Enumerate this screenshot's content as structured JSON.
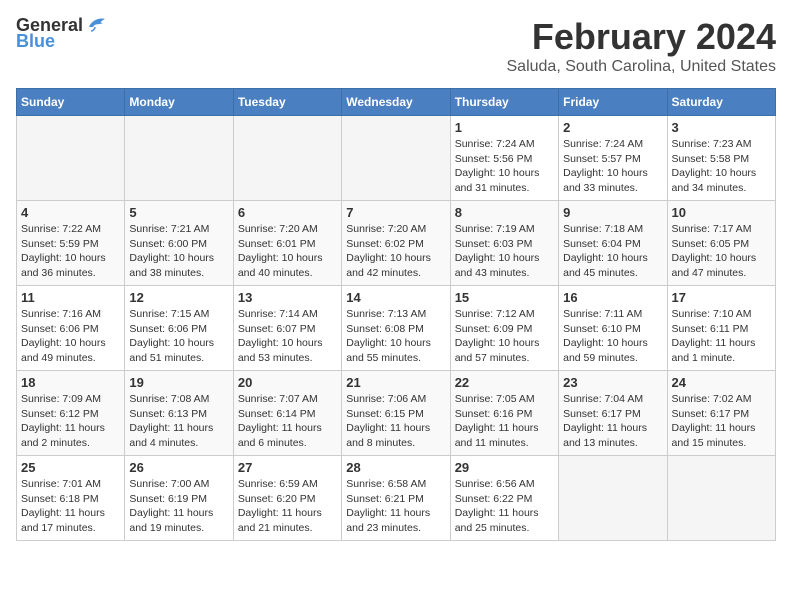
{
  "header": {
    "logo_line1": "General",
    "logo_line2": "Blue",
    "month": "February 2024",
    "location": "Saluda, South Carolina, United States"
  },
  "weekdays": [
    "Sunday",
    "Monday",
    "Tuesday",
    "Wednesday",
    "Thursday",
    "Friday",
    "Saturday"
  ],
  "weeks": [
    [
      {
        "day": "",
        "info": ""
      },
      {
        "day": "",
        "info": ""
      },
      {
        "day": "",
        "info": ""
      },
      {
        "day": "",
        "info": ""
      },
      {
        "day": "1",
        "info": "Sunrise: 7:24 AM\nSunset: 5:56 PM\nDaylight: 10 hours\nand 31 minutes."
      },
      {
        "day": "2",
        "info": "Sunrise: 7:24 AM\nSunset: 5:57 PM\nDaylight: 10 hours\nand 33 minutes."
      },
      {
        "day": "3",
        "info": "Sunrise: 7:23 AM\nSunset: 5:58 PM\nDaylight: 10 hours\nand 34 minutes."
      }
    ],
    [
      {
        "day": "4",
        "info": "Sunrise: 7:22 AM\nSunset: 5:59 PM\nDaylight: 10 hours\nand 36 minutes."
      },
      {
        "day": "5",
        "info": "Sunrise: 7:21 AM\nSunset: 6:00 PM\nDaylight: 10 hours\nand 38 minutes."
      },
      {
        "day": "6",
        "info": "Sunrise: 7:20 AM\nSunset: 6:01 PM\nDaylight: 10 hours\nand 40 minutes."
      },
      {
        "day": "7",
        "info": "Sunrise: 7:20 AM\nSunset: 6:02 PM\nDaylight: 10 hours\nand 42 minutes."
      },
      {
        "day": "8",
        "info": "Sunrise: 7:19 AM\nSunset: 6:03 PM\nDaylight: 10 hours\nand 43 minutes."
      },
      {
        "day": "9",
        "info": "Sunrise: 7:18 AM\nSunset: 6:04 PM\nDaylight: 10 hours\nand 45 minutes."
      },
      {
        "day": "10",
        "info": "Sunrise: 7:17 AM\nSunset: 6:05 PM\nDaylight: 10 hours\nand 47 minutes."
      }
    ],
    [
      {
        "day": "11",
        "info": "Sunrise: 7:16 AM\nSunset: 6:06 PM\nDaylight: 10 hours\nand 49 minutes."
      },
      {
        "day": "12",
        "info": "Sunrise: 7:15 AM\nSunset: 6:06 PM\nDaylight: 10 hours\nand 51 minutes."
      },
      {
        "day": "13",
        "info": "Sunrise: 7:14 AM\nSunset: 6:07 PM\nDaylight: 10 hours\nand 53 minutes."
      },
      {
        "day": "14",
        "info": "Sunrise: 7:13 AM\nSunset: 6:08 PM\nDaylight: 10 hours\nand 55 minutes."
      },
      {
        "day": "15",
        "info": "Sunrise: 7:12 AM\nSunset: 6:09 PM\nDaylight: 10 hours\nand 57 minutes."
      },
      {
        "day": "16",
        "info": "Sunrise: 7:11 AM\nSunset: 6:10 PM\nDaylight: 10 hours\nand 59 minutes."
      },
      {
        "day": "17",
        "info": "Sunrise: 7:10 AM\nSunset: 6:11 PM\nDaylight: 11 hours\nand 1 minute."
      }
    ],
    [
      {
        "day": "18",
        "info": "Sunrise: 7:09 AM\nSunset: 6:12 PM\nDaylight: 11 hours\nand 2 minutes."
      },
      {
        "day": "19",
        "info": "Sunrise: 7:08 AM\nSunset: 6:13 PM\nDaylight: 11 hours\nand 4 minutes."
      },
      {
        "day": "20",
        "info": "Sunrise: 7:07 AM\nSunset: 6:14 PM\nDaylight: 11 hours\nand 6 minutes."
      },
      {
        "day": "21",
        "info": "Sunrise: 7:06 AM\nSunset: 6:15 PM\nDaylight: 11 hours\nand 8 minutes."
      },
      {
        "day": "22",
        "info": "Sunrise: 7:05 AM\nSunset: 6:16 PM\nDaylight: 11 hours\nand 11 minutes."
      },
      {
        "day": "23",
        "info": "Sunrise: 7:04 AM\nSunset: 6:17 PM\nDaylight: 11 hours\nand 13 minutes."
      },
      {
        "day": "24",
        "info": "Sunrise: 7:02 AM\nSunset: 6:17 PM\nDaylight: 11 hours\nand 15 minutes."
      }
    ],
    [
      {
        "day": "25",
        "info": "Sunrise: 7:01 AM\nSunset: 6:18 PM\nDaylight: 11 hours\nand 17 minutes."
      },
      {
        "day": "26",
        "info": "Sunrise: 7:00 AM\nSunset: 6:19 PM\nDaylight: 11 hours\nand 19 minutes."
      },
      {
        "day": "27",
        "info": "Sunrise: 6:59 AM\nSunset: 6:20 PM\nDaylight: 11 hours\nand 21 minutes."
      },
      {
        "day": "28",
        "info": "Sunrise: 6:58 AM\nSunset: 6:21 PM\nDaylight: 11 hours\nand 23 minutes."
      },
      {
        "day": "29",
        "info": "Sunrise: 6:56 AM\nSunset: 6:22 PM\nDaylight: 11 hours\nand 25 minutes."
      },
      {
        "day": "",
        "info": ""
      },
      {
        "day": "",
        "info": ""
      }
    ]
  ]
}
